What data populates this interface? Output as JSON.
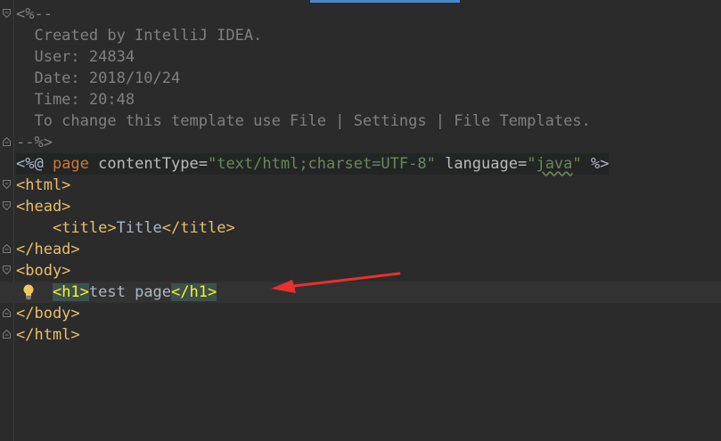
{
  "editor": {
    "accent_color": "#4a88c7",
    "background": "#2b2b2b",
    "lines": {
      "l0": "<%--",
      "l1": "  Created by IntelliJ IDEA.",
      "l2": "  User: 24834",
      "l3": "  Date: 2018/10/24",
      "l4": "  Time: 20:48",
      "l5": "  To change this template use File | Settings | File Templates.",
      "l6": "--%>",
      "l7": {
        "open": "<%@ ",
        "page_kw": "page",
        "attr1": " contentType=",
        "val1": "\"text/html;charset=UTF-8\"",
        "attr2": " language=",
        "val2_q1": "\"",
        "val2": "java",
        "val2_q2": "\"",
        "close": " %>"
      },
      "l8": "<html>",
      "l9": "<head>",
      "l10": {
        "indent": "    ",
        "open_tag": "<title>",
        "text": "Title",
        "close_tag": "</title>"
      },
      "l11": "</head>",
      "l12": "<body>",
      "l13": {
        "indent": "    ",
        "open_tag": "<h1>",
        "text": "test page",
        "close_tag": "</h1>"
      },
      "l14": "</body>",
      "l15": "</html>"
    },
    "icons": {
      "fold": "fold-marker-icon",
      "intention": "lightbulb-icon",
      "annotation": "red-arrow-icon"
    }
  }
}
